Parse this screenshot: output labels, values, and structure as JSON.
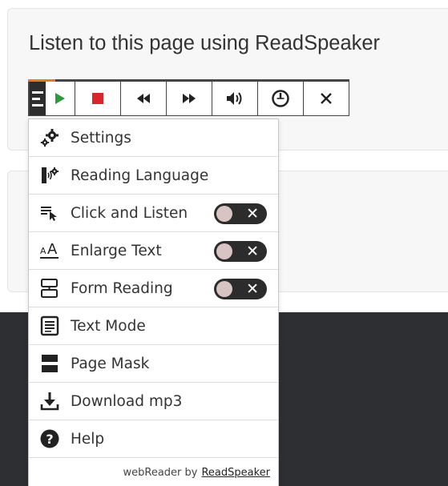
{
  "page": {
    "heading": "Listen to this page using ReadSpeaker"
  },
  "player": {
    "buttons": [
      {
        "name": "menu-play",
        "icon": "play-icon"
      },
      {
        "name": "stop",
        "icon": "stop-icon"
      },
      {
        "name": "rewind",
        "icon": "rewind-icon"
      },
      {
        "name": "fast-forward",
        "icon": "fast-forward-icon"
      },
      {
        "name": "volume",
        "icon": "volume-icon"
      },
      {
        "name": "speed",
        "icon": "speed-icon"
      },
      {
        "name": "close",
        "icon": "close-icon"
      }
    ],
    "colors": {
      "play": "#2e9a3e",
      "stop": "#d9262c",
      "progress": "#e8782a"
    }
  },
  "menu": {
    "items": [
      {
        "label": "Settings",
        "icon": "gears-icon"
      },
      {
        "label": "Reading Language",
        "icon": "speaking-head-icon"
      },
      {
        "label": "Click and Listen",
        "icon": "click-listen-icon",
        "toggle": "off"
      },
      {
        "label": "Enlarge Text",
        "icon": "enlarge-text-icon",
        "toggle": "off"
      },
      {
        "label": "Form Reading",
        "icon": "form-reading-icon",
        "toggle": "off"
      },
      {
        "label": "Text Mode",
        "icon": "text-mode-icon"
      },
      {
        "label": "Page Mask",
        "icon": "page-mask-icon"
      },
      {
        "label": "Download mp3",
        "icon": "download-icon"
      },
      {
        "label": "Help",
        "icon": "help-icon"
      }
    ],
    "toggle_symbol": "✕",
    "footer": {
      "prefix": "webReader by",
      "brand": "ReadSpeaker"
    }
  }
}
